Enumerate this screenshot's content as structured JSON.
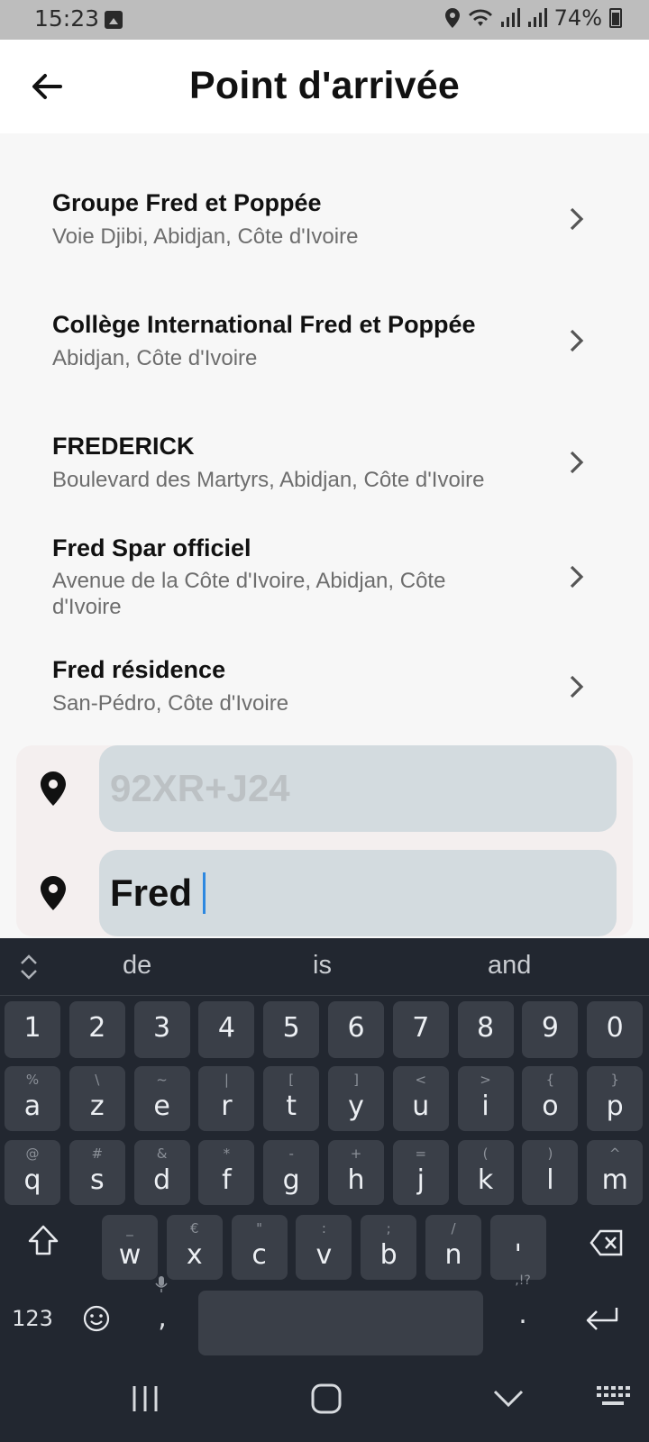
{
  "status_bar": {
    "time": "15:23",
    "battery": "74%",
    "icons": [
      "gallery-icon",
      "location-icon",
      "wifi-icon",
      "signal-icon",
      "signal-icon",
      "battery-icon"
    ]
  },
  "header": {
    "title": "Point d'arrivée",
    "back_icon": "arrow-left-icon"
  },
  "results": [
    {
      "title": "Groupe Fred et Poppée",
      "subtitle": "Voie Djibi, Abidjan, Côte d'Ivoire"
    },
    {
      "title": "Collège International Fred et Poppée",
      "subtitle": "Abidjan, Côte d'Ivoire"
    },
    {
      "title": "FREDERICK",
      "subtitle": "Boulevard des Martyrs, Abidjan, Côte d'Ivoire"
    },
    {
      "title": "Fred Spar officiel",
      "subtitle": "Avenue de la Côte d'Ivoire, Abidjan, Côte d'Ivoire"
    },
    {
      "title": "Fred résidence",
      "subtitle": "San-Pédro, Côte d'Ivoire"
    }
  ],
  "inputs": {
    "start_placeholder": "92XR+J24",
    "destination_value": "Fred"
  },
  "keyboard": {
    "suggestions": [
      "de",
      "is",
      "and"
    ],
    "number_row": [
      "1",
      "2",
      "3",
      "4",
      "5",
      "6",
      "7",
      "8",
      "9",
      "0"
    ],
    "row1": [
      {
        "main": "a",
        "alt": "%"
      },
      {
        "main": "z",
        "alt": "\\"
      },
      {
        "main": "e",
        "alt": "~"
      },
      {
        "main": "r",
        "alt": "|"
      },
      {
        "main": "t",
        "alt": "["
      },
      {
        "main": "y",
        "alt": "]"
      },
      {
        "main": "u",
        "alt": "<"
      },
      {
        "main": "i",
        "alt": ">"
      },
      {
        "main": "o",
        "alt": "{"
      },
      {
        "main": "p",
        "alt": "}"
      }
    ],
    "row2": [
      {
        "main": "q",
        "alt": "@"
      },
      {
        "main": "s",
        "alt": "#"
      },
      {
        "main": "d",
        "alt": "&"
      },
      {
        "main": "f",
        "alt": "*"
      },
      {
        "main": "g",
        "alt": "-"
      },
      {
        "main": "h",
        "alt": "+"
      },
      {
        "main": "j",
        "alt": "="
      },
      {
        "main": "k",
        "alt": "("
      },
      {
        "main": "l",
        "alt": ")"
      },
      {
        "main": "m",
        "alt": "^"
      }
    ],
    "row3": [
      {
        "main": "w",
        "alt": "_"
      },
      {
        "main": "x",
        "alt": "€"
      },
      {
        "main": "c",
        "alt": "\""
      },
      {
        "main": "v",
        "alt": ":"
      },
      {
        "main": "b",
        "alt": ";"
      },
      {
        "main": "n",
        "alt": "/"
      },
      {
        "main": "'",
        "alt": ""
      }
    ],
    "bottom": {
      "symbols_label": "123",
      "comma": ",",
      "period": ".",
      "period_alt": ",!?"
    }
  },
  "colors": {
    "accent_caret": "#2d88e0",
    "field_bg": "#d3dbdf",
    "keyboard_bg": "#222730",
    "key_bg": "#3a3f48"
  }
}
